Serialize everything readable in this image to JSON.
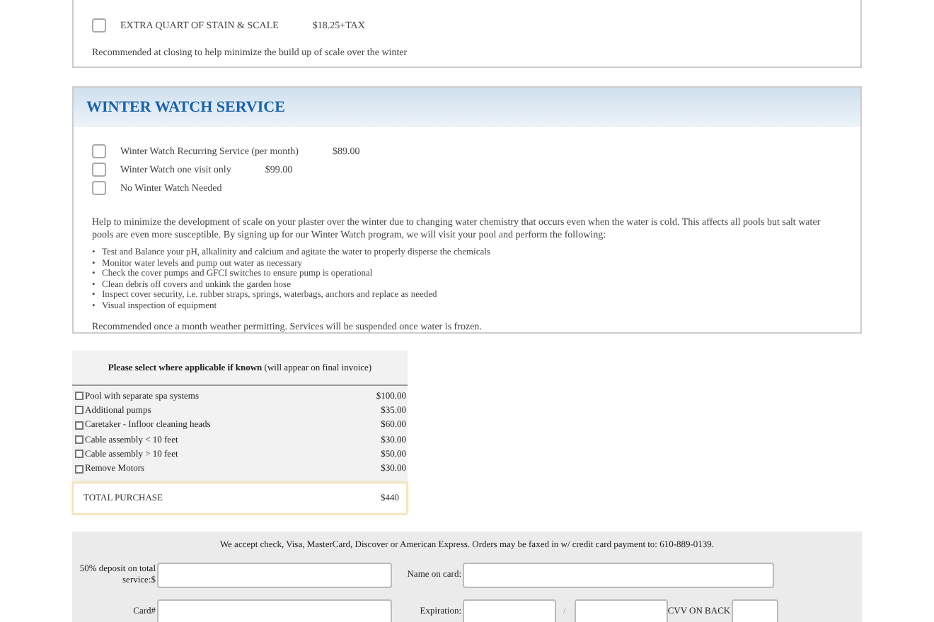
{
  "closing_section": {
    "options": [
      {
        "label": "EXTRA QUART OF STAIN & SCALE",
        "price": "$18.25+TAX",
        "checked": false
      }
    ],
    "note": "Recommended at closing to help minimize the build up of scale over the winter"
  },
  "winter_watch": {
    "title": "WINTER WATCH SERVICE",
    "options": [
      {
        "label": "Winter Watch Recurring Service (per month)",
        "price": "$89.00",
        "checked": false
      },
      {
        "label": "Winter Watch one visit only",
        "price": "$99.00",
        "checked": false
      },
      {
        "label": "No Winter Watch Needed",
        "checked": false
      }
    ],
    "description": "Help to minimize the development of scale on your plaster over the winter due to changing water chemistry that occurs even when the water is cold. This affects all pools but salt water pools are even more susceptible. By signing up for our Winter Watch program, we will visit your pool and perform the following:",
    "tasks": [
      {
        "bullet": "•",
        "text": "Test and Balance your pH, alkalinity and calcium and agitate the water to properly disperse the chemicals"
      },
      {
        "bullet": "•",
        "text": "Monitor water levels and pump out water as necessary"
      },
      {
        "bullet": "•",
        "text": "Check the cover pumps and GFCI switches to ensure pump is operational"
      },
      {
        "bullet": "•",
        "text": "Clean debris off covers and unkink the garden hose"
      },
      {
        "bullet": "•",
        "text": "Inspect cover security, i.e. rubber straps, springs, waterbags, anchors and replace as needed"
      },
      {
        "bullet": "•",
        "text": "Visual inspection of equipment"
      }
    ],
    "note": "Recommended once a month weather permitting. Services will be suspended once water is frozen."
  },
  "extras": {
    "heading": "**Please select where applicable if known** (will appear on final invoice)",
    "items": [
      {
        "label": "Pool with separate spa systems",
        "price": "$100.00",
        "checked": false
      },
      {
        "label": "Additional pumps",
        "price": "$35.00",
        "checked": false
      },
      {
        "label": "Caretaker - Infloor cleaning heads",
        "price": "$60.00",
        "checked": false
      },
      {
        "label": "Cable assembly < 10 feet",
        "price": "$30.00",
        "checked": false
      },
      {
        "label": "Cable assembly > 10 feet",
        "price": "$50.00",
        "checked": false
      },
      {
        "label": "Remove Motors",
        "price": "$30.00",
        "checked": false
      }
    ],
    "total_label": "TOTAL PURCHASE",
    "total": "$440"
  },
  "payment": {
    "notice": "We accept check, Visa, MasterCard, Discover or American Express. Orders may be faxed in w/ credit card payment to: 610-889-0139.",
    "rows": [
      [
        {
          "label": "50% deposit on total service:$",
          "kind": "wide"
        },
        {
          "label": "Name on card:",
          "kind": "wide"
        }
      ],
      [
        {
          "label": "Card#",
          "kind": "wide"
        },
        {
          "label": "Expiration:",
          "kind": "short"
        },
        {
          "label": "/",
          "kind": "short"
        },
        {
          "label": "CVV ON BACK",
          "kind": "tiny"
        }
      ]
    ]
  }
}
